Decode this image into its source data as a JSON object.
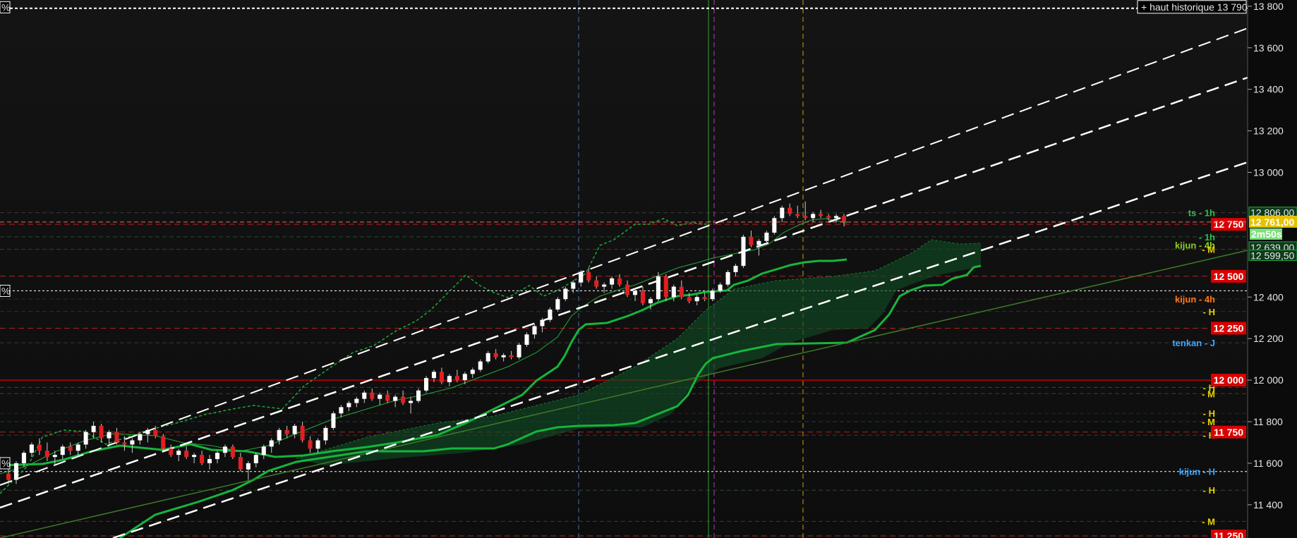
{
  "chart_data": {
    "type": "candlestick",
    "ylim": [
      11240,
      13830
    ],
    "y_ticks": [
      {
        "value": 13800,
        "label": "13 800"
      },
      {
        "value": 13600,
        "label": "13 600"
      },
      {
        "value": 13400,
        "label": "13 400"
      },
      {
        "value": 13200,
        "label": "13 200"
      },
      {
        "value": 13000,
        "label": "13 000"
      },
      {
        "value": 12400,
        "label": "12 400"
      },
      {
        "value": 12200,
        "label": "12 200"
      },
      {
        "value": 12000,
        "label": "12 000"
      },
      {
        "value": 11800,
        "label": "11 800"
      },
      {
        "value": 11600,
        "label": "11 600"
      },
      {
        "value": 11400,
        "label": "11 400"
      }
    ],
    "price_levels": [
      {
        "value": 12750,
        "label": "12 750"
      },
      {
        "value": 12500,
        "label": "12 500"
      },
      {
        "value": 12250,
        "label": "12 250"
      },
      {
        "value": 12000,
        "label": "12 000"
      },
      {
        "value": 11750,
        "label": "11 750"
      },
      {
        "value": 11250,
        "label": "11 250"
      }
    ],
    "current_price": {
      "value": 12761,
      "label": "12 761,00",
      "timer": "2m50s"
    },
    "historic_high": {
      "value": 13790,
      "label": "+ haut historique 13 790"
    },
    "right_axis_values": [
      {
        "value": 12806,
        "label": "12 806,00",
        "color": "#1fa83a"
      },
      {
        "value": 12639,
        "label": "12 639,00",
        "color": "#1fa83a"
      },
      {
        "value": 12599.5,
        "label": "12 599,50",
        "color": "#1fa83a"
      }
    ],
    "annotations": [
      {
        "value": 12806,
        "label": "ts - 1h",
        "color": "#2fbf4a"
      },
      {
        "value": 12690,
        "label": "- 1h",
        "color": "#2fbf4a"
      },
      {
        "value": 12650,
        "label": "kijun - 4h",
        "color": "#8ecf2a"
      },
      {
        "value": 12630,
        "label": "- M",
        "color": "#e6d200"
      },
      {
        "value": 12390,
        "label": "kijun - 4h",
        "color": "#ff7a1a"
      },
      {
        "value": 12330,
        "label": "- H",
        "color": "#e6d200"
      },
      {
        "value": 12180,
        "label": "tenkan - J",
        "color": "#3fa8ff"
      },
      {
        "value": 11965,
        "label": "- H",
        "color": "#e6d200"
      },
      {
        "value": 11935,
        "label": "- M",
        "color": "#e6d200"
      },
      {
        "value": 11840,
        "label": "- H",
        "color": "#e6d200"
      },
      {
        "value": 11800,
        "label": "- M",
        "color": "#e6d200"
      },
      {
        "value": 11735,
        "label": "- H",
        "color": "#e6d200"
      },
      {
        "value": 11560,
        "label": "kijun - H",
        "color": "#3fa8ff"
      },
      {
        "value": 11470,
        "label": "- H",
        "color": "#e6d200"
      },
      {
        "value": 11320,
        "label": "- M",
        "color": "#e6d200"
      }
    ],
    "left_marks": [
      {
        "value": 13795,
        "label": "%"
      },
      {
        "value": 12430,
        "label": "%"
      },
      {
        "value": 11600,
        "label": "%"
      }
    ],
    "candles": [
      [
        11550,
        11580,
        11500,
        11520
      ],
      [
        11520,
        11610,
        11500,
        11600
      ],
      [
        11600,
        11660,
        11580,
        11650
      ],
      [
        11650,
        11700,
        11630,
        11690
      ],
      [
        11690,
        11720,
        11640,
        11660
      ],
      [
        11660,
        11700,
        11610,
        11630
      ],
      [
        11630,
        11660,
        11590,
        11640
      ],
      [
        11640,
        11690,
        11620,
        11680
      ],
      [
        11680,
        11700,
        11640,
        11660
      ],
      [
        11660,
        11700,
        11630,
        11690
      ],
      [
        11690,
        11760,
        11670,
        11750
      ],
      [
        11750,
        11800,
        11720,
        11780
      ],
      [
        11780,
        11790,
        11700,
        11720
      ],
      [
        11720,
        11760,
        11680,
        11750
      ],
      [
        11750,
        11770,
        11690,
        11700
      ],
      [
        11700,
        11730,
        11660,
        11690
      ],
      [
        11690,
        11720,
        11650,
        11710
      ],
      [
        11710,
        11750,
        11690,
        11740
      ],
      [
        11740,
        11770,
        11700,
        11760
      ],
      [
        11760,
        11780,
        11720,
        11730
      ],
      [
        11730,
        11740,
        11660,
        11670
      ],
      [
        11670,
        11690,
        11630,
        11640
      ],
      [
        11640,
        11670,
        11610,
        11660
      ],
      [
        11660,
        11680,
        11620,
        11630
      ],
      [
        11630,
        11650,
        11600,
        11640
      ],
      [
        11640,
        11660,
        11590,
        11600
      ],
      [
        11600,
        11640,
        11570,
        11620
      ],
      [
        11620,
        11660,
        11600,
        11650
      ],
      [
        11650,
        11690,
        11630,
        11680
      ],
      [
        11680,
        11690,
        11620,
        11630
      ],
      [
        11630,
        11650,
        11560,
        11570
      ],
      [
        11570,
        11610,
        11520,
        11600
      ],
      [
        11600,
        11650,
        11580,
        11640
      ],
      [
        11640,
        11690,
        11620,
        11680
      ],
      [
        11680,
        11720,
        11650,
        11710
      ],
      [
        11710,
        11770,
        11690,
        11760
      ],
      [
        11760,
        11780,
        11720,
        11740
      ],
      [
        11740,
        11790,
        11720,
        11780
      ],
      [
        11780,
        11800,
        11700,
        11710
      ],
      [
        11710,
        11730,
        11650,
        11670
      ],
      [
        11670,
        11720,
        11650,
        11710
      ],
      [
        11710,
        11780,
        11690,
        11770
      ],
      [
        11770,
        11850,
        11760,
        11840
      ],
      [
        11840,
        11880,
        11820,
        11870
      ],
      [
        11870,
        11900,
        11850,
        11890
      ],
      [
        11890,
        11920,
        11870,
        11910
      ],
      [
        11910,
        11950,
        11890,
        11940
      ],
      [
        11940,
        11960,
        11900,
        11910
      ],
      [
        11910,
        11940,
        11880,
        11930
      ],
      [
        11930,
        11950,
        11890,
        11900
      ],
      [
        11900,
        11930,
        11870,
        11920
      ],
      [
        11920,
        11950,
        11880,
        11890
      ],
      [
        11890,
        11920,
        11840,
        11900
      ],
      [
        11900,
        11960,
        11890,
        11950
      ],
      [
        11950,
        12020,
        11940,
        12010
      ],
      [
        12010,
        12050,
        11990,
        12040
      ],
      [
        12040,
        12060,
        11980,
        11990
      ],
      [
        11990,
        12030,
        11970,
        12020
      ],
      [
        12020,
        12050,
        11990,
        12000
      ],
      [
        12000,
        12040,
        11980,
        12030
      ],
      [
        12030,
        12060,
        12010,
        12050
      ],
      [
        12050,
        12100,
        12040,
        12090
      ],
      [
        12090,
        12140,
        12080,
        12130
      ],
      [
        12130,
        12150,
        12100,
        12110
      ],
      [
        12110,
        12130,
        12090,
        12120
      ],
      [
        12120,
        12140,
        12100,
        12110
      ],
      [
        12110,
        12180,
        12100,
        12170
      ],
      [
        12170,
        12230,
        12160,
        12220
      ],
      [
        12220,
        12270,
        12200,
        12260
      ],
      [
        12260,
        12300,
        12230,
        12290
      ],
      [
        12290,
        12350,
        12280,
        12340
      ],
      [
        12340,
        12400,
        12330,
        12390
      ],
      [
        12390,
        12450,
        12380,
        12440
      ],
      [
        12440,
        12480,
        12420,
        12470
      ],
      [
        12470,
        12530,
        12450,
        12520
      ],
      [
        12520,
        12540,
        12470,
        12480
      ],
      [
        12480,
        12500,
        12440,
        12450
      ],
      [
        12450,
        12470,
        12420,
        12460
      ],
      [
        12460,
        12500,
        12440,
        12490
      ],
      [
        12490,
        12510,
        12450,
        12460
      ],
      [
        12460,
        12480,
        12400,
        12410
      ],
      [
        12410,
        12440,
        12380,
        12430
      ],
      [
        12430,
        12450,
        12360,
        12370
      ],
      [
        12370,
        12400,
        12340,
        12390
      ],
      [
        12390,
        12520,
        12380,
        12500
      ],
      [
        12500,
        12510,
        12380,
        12400
      ],
      [
        12400,
        12460,
        12380,
        12450
      ],
      [
        12450,
        12480,
        12390,
        12400
      ],
      [
        12400,
        12420,
        12370,
        12380
      ],
      [
        12380,
        12410,
        12360,
        12400
      ],
      [
        12400,
        12420,
        12380,
        12390
      ],
      [
        12390,
        12440,
        12380,
        12430
      ],
      [
        12430,
        12470,
        12420,
        12460
      ],
      [
        12460,
        12530,
        12450,
        12520
      ],
      [
        12520,
        12560,
        12500,
        12550
      ],
      [
        12550,
        12700,
        12540,
        12690
      ],
      [
        12690,
        12720,
        12640,
        12650
      ],
      [
        12650,
        12680,
        12600,
        12670
      ],
      [
        12670,
        12720,
        12650,
        12710
      ],
      [
        12710,
        12790,
        12700,
        12780
      ],
      [
        12780,
        12840,
        12760,
        12830
      ],
      [
        12830,
        12850,
        12790,
        12800
      ],
      [
        12800,
        12840,
        12780,
        12790
      ],
      [
        12790,
        12860,
        12770,
        12780
      ],
      [
        12780,
        12810,
        12760,
        12800
      ],
      [
        12800,
        12820,
        12780,
        12790
      ],
      [
        12790,
        12800,
        12770,
        12780
      ],
      [
        12780,
        12800,
        12760,
        12790
      ],
      [
        12790,
        12800,
        12740,
        12761
      ]
    ]
  }
}
